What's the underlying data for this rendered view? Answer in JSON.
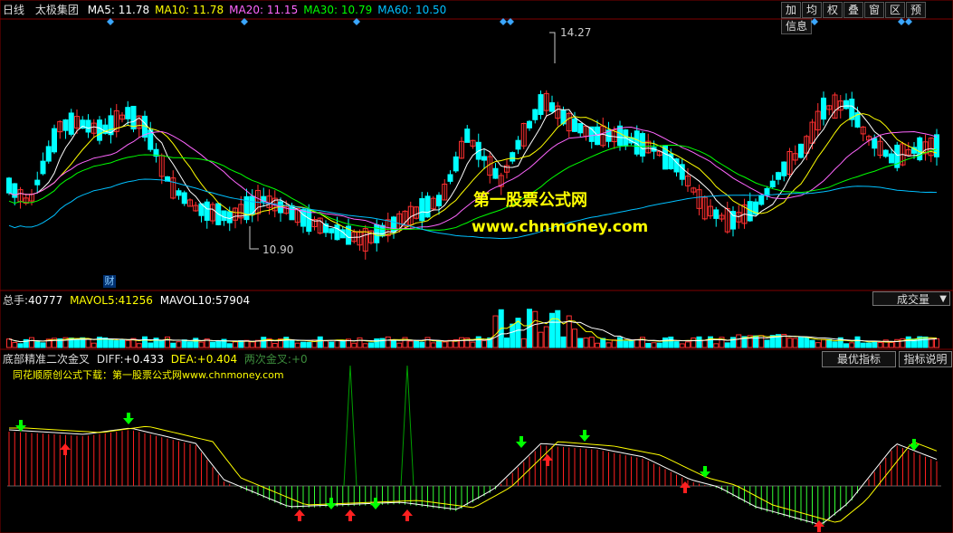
{
  "header": {
    "period": "日线",
    "stock": "太极集团",
    "ma": [
      {
        "label": "MA5:",
        "value": "11.78",
        "color": "#ffffff"
      },
      {
        "label": "MA10:",
        "value": "11.78",
        "color": "#ffff00"
      },
      {
        "label": "MA20:",
        "value": "11.15",
        "color": "#ff66ff"
      },
      {
        "label": "MA30:",
        "value": "10.79",
        "color": "#00ff00"
      },
      {
        "label": "MA60:",
        "value": "10.50",
        "color": "#00c0ff"
      }
    ],
    "toolbar": [
      "加",
      "均",
      "权",
      "叠",
      "窗",
      "区",
      "预",
      "信息"
    ]
  },
  "price_panel": {
    "high_label": "14.27",
    "low_label": "10.90",
    "marker": "财"
  },
  "volume_panel": {
    "label_total": "总手:",
    "total": "40777",
    "label_mavol5": "MAVOL5:",
    "mavol5": "41256",
    "label_mavol10": "MAVOL10:",
    "mavol10": "57904",
    "selector": "成交量",
    "selector_arrow": "▼"
  },
  "indicator_panel": {
    "name": "底部精准二次金叉",
    "diff_label": "DIFF:",
    "diff": "+0.433",
    "dea_label": "DEA:",
    "dea": "+0.404",
    "cross_label": "两次金叉:",
    "cross": "+0",
    "best_button": "最优指标",
    "help_button": "指标说明",
    "promo": "同花顺原创公式下载：第一股票公式网www.chnmoney.com"
  },
  "watermark": {
    "line1": "第一股票公式网",
    "line2": "www.chnmoney.com"
  },
  "colors": {
    "up": "#ff3030",
    "down": "#00ffff",
    "hist_pos": "#ff2020",
    "hist_neg": "#33ff33",
    "buy_arrow": "#ff2020",
    "sell_arrow": "#00ff00"
  }
}
